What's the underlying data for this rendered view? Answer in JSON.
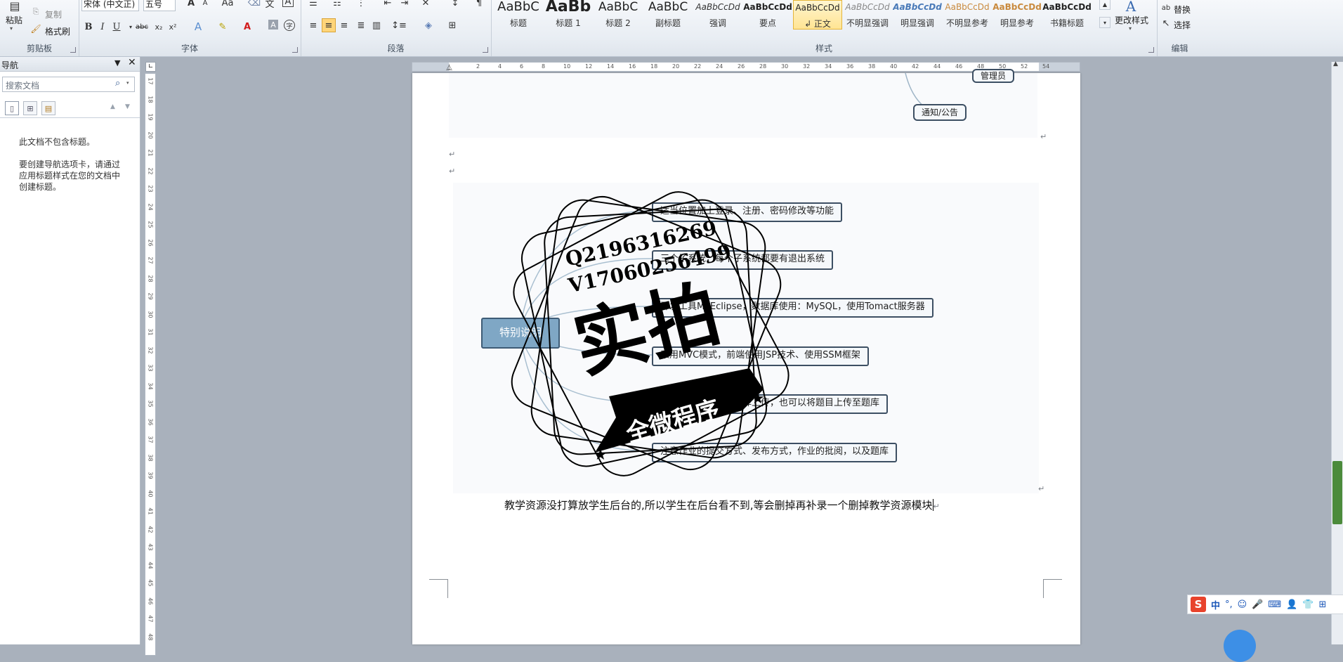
{
  "ribbon": {
    "clipboard": {
      "label": "剪贴板",
      "paste": "粘贴",
      "copy": "复制",
      "format_painter": "格式刷"
    },
    "font": {
      "label": "字体",
      "font_name": "宋体 (中文正)",
      "font_size": "五号"
    },
    "paragraph": {
      "label": "段落"
    },
    "styles": {
      "label": "样式",
      "items": [
        {
          "preview": "AaBbC",
          "name": "标题"
        },
        {
          "preview": "AaBb",
          "name": "标题 1"
        },
        {
          "preview": "AaBbC",
          "name": "标题 2"
        },
        {
          "preview": "AaBbC",
          "name": "副标题"
        },
        {
          "preview": "AaBbCcDd",
          "name": "强调"
        },
        {
          "preview": "AaBbCcDd",
          "name": "要点"
        },
        {
          "preview": "AaBbCcDd",
          "name": "↲ 正文"
        },
        {
          "preview": "AaBbCcDd",
          "name": "不明显强调"
        },
        {
          "preview": "AaBbCcDd",
          "name": "明显强调"
        },
        {
          "preview": "AaBbCcDd",
          "name": "不明显参考"
        },
        {
          "preview": "AaBbCcDd",
          "name": "明显参考"
        },
        {
          "preview": "AaBbCcDd",
          "name": "书籍标题"
        }
      ],
      "change_styles": "更改样式"
    },
    "editing": {
      "label": "编辑",
      "replace": "替换",
      "select": "选择"
    }
  },
  "nav_pane": {
    "title": "导航",
    "search_placeholder": "搜索文档",
    "message_1": "此文档不包含标题。",
    "message_2": "要创建导航选项卡，请通过应用标题样式在您的文档中创建标题。"
  },
  "document": {
    "top_diagram": {
      "node_admin": "管理员",
      "node_notice": "通知/公告"
    },
    "mindmap": {
      "center": "特别说明",
      "branches": [
        "适当位置加上登录、注册、密码修改等功能",
        "三个子系统，每个子系统都要有退出系统",
        "开发工具MyEclipse，数据库使用：MySQL，使用Tomact服务器",
        "采用MVC模式，前端使用JSP技术、使用SSM框架",
        "题库可以从题库中选择上传，也可以将题目上传至题库",
        "注意作业的提交方式、发布方式，作业的批阅，以及题库"
      ]
    },
    "body_text": "教学资源没打算放学生后台的,所以学生在后台看不到,等会删掉再补录一个删掉教学资源模块"
  },
  "watermark": {
    "line1": "Q2196316269",
    "line2": "V17060256499",
    "big": "实拍",
    "banner": "全微程序"
  },
  "ime": {
    "logo": "S",
    "mode": "中"
  },
  "colors": {
    "accent": "#7fa7c5",
    "node_border": "#3d4f63",
    "page_bg": "#a9b1bc"
  }
}
